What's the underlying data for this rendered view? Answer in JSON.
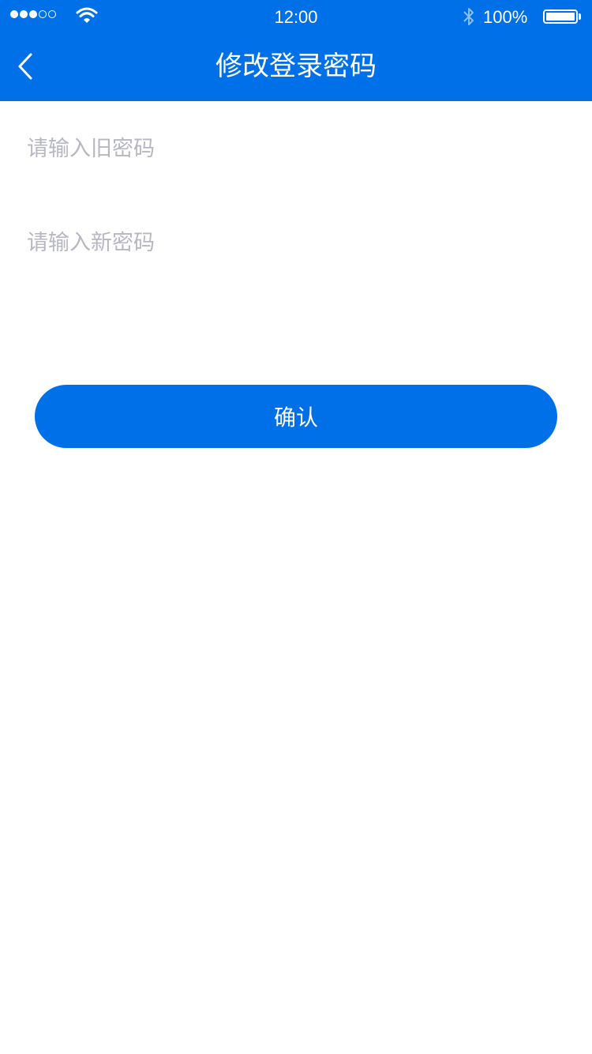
{
  "status_bar": {
    "time": "12:00",
    "battery_percent": "100%",
    "signal_strength": 3,
    "signal_total": 5,
    "icons": [
      "wifi-icon",
      "bluetooth-icon",
      "battery-icon"
    ]
  },
  "nav": {
    "title": "修改登录密码",
    "back_icon": "chevron-left-icon"
  },
  "form": {
    "old_password": {
      "placeholder": "请输入旧密码",
      "value": ""
    },
    "new_password": {
      "placeholder": "请输入新密码",
      "value": ""
    },
    "confirm_label": "确认"
  },
  "colors": {
    "primary": "#0070e8",
    "placeholder": "#b7b7c4",
    "background": "#ffffff"
  }
}
